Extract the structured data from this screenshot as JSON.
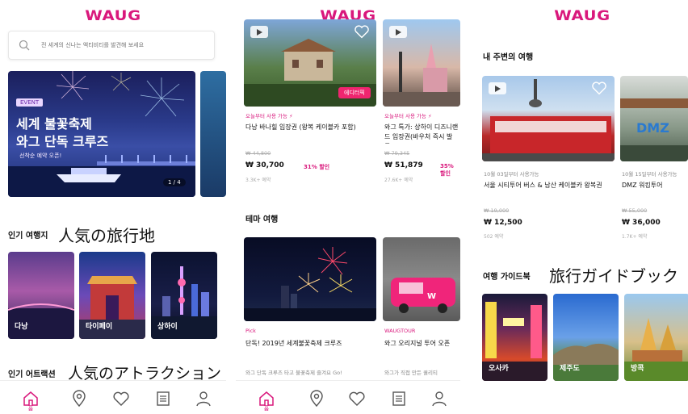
{
  "brand": {
    "logo": "WAUG",
    "accent": "#d9187c"
  },
  "screen1": {
    "search": {
      "placeholder": "전 세계의 신나는 액티비티를 발견해 보세요"
    },
    "banner": {
      "badge": "EVENT",
      "title_line1": "세계 불꽃축제",
      "title_line2": "와그 단독 크루즈",
      "subtitle": "선착순 예약 오픈!",
      "pager": "1 / 4"
    },
    "popular_destinations": {
      "title": "인기 여행지",
      "jp_caption": "人気の旅行地",
      "cities": [
        {
          "name": "다낭"
        },
        {
          "name": "타이페이"
        },
        {
          "name": "상하이"
        }
      ]
    },
    "popular_attractions": {
      "title": "인기 어트랙션",
      "jp_caption": "人気のアトラクション"
    },
    "tabbar": {
      "home_label": "홈"
    }
  },
  "screen2": {
    "products": [
      {
        "tag": "오늘부터 사용 가능 ⚡",
        "title": "다낭 바나힐 입장권 (왕복 케이블카 포함)",
        "old_price": "₩ 44,800",
        "price": "₩ 30,700",
        "discount": "31% 할인",
        "meta": "3.3K+ 예약",
        "badge": "에디터픽"
      },
      {
        "tag": "오늘부터 사용 가능 ⚡",
        "title": "와그 특가: 상하이 디즈니랜드 입장권(바우처 즉시 발급)",
        "old_price": "₩ 79,345",
        "price": "₩ 51,879",
        "discount": "35% 할인",
        "meta": "27.6K+ 예약"
      }
    ],
    "theme": {
      "title": "테마 여행",
      "items": [
        {
          "tag": "Pick",
          "title": "단독! 2019년 세계불꽃축제 크루즈",
          "desc": "와그 단독 크루즈 타고 불꽃축제 즐겨요 Go!"
        },
        {
          "tag": "WAUGTOUR",
          "title": "와그 오리지널 투어 오픈",
          "desc": "와그가 직접 만든 퀄리티"
        }
      ]
    },
    "tabbar": {
      "home_label": "홈"
    }
  },
  "screen3": {
    "nearby": {
      "title": "내 주변의 여행",
      "items": [
        {
          "tag": "10월 03일부터 사용가능",
          "title": "서울 시티투어 버스 & 남산 케이블카 왕복권",
          "old_price": "₩ 19,000",
          "price": "₩ 12,500",
          "meta": "502 예약"
        },
        {
          "tag": "10월 15일부터 사용가능",
          "title": "DMZ 워킹투어",
          "old_price": "₩ 55,000",
          "price": "₩ 36,000",
          "meta": "1.7K+ 예약"
        }
      ]
    },
    "guide": {
      "title": "여행 가이드북",
      "jp_caption": "旅行ガイドブック",
      "cities": [
        {
          "name": "오사카"
        },
        {
          "name": "제주도"
        },
        {
          "name": "방콕"
        }
      ]
    }
  }
}
